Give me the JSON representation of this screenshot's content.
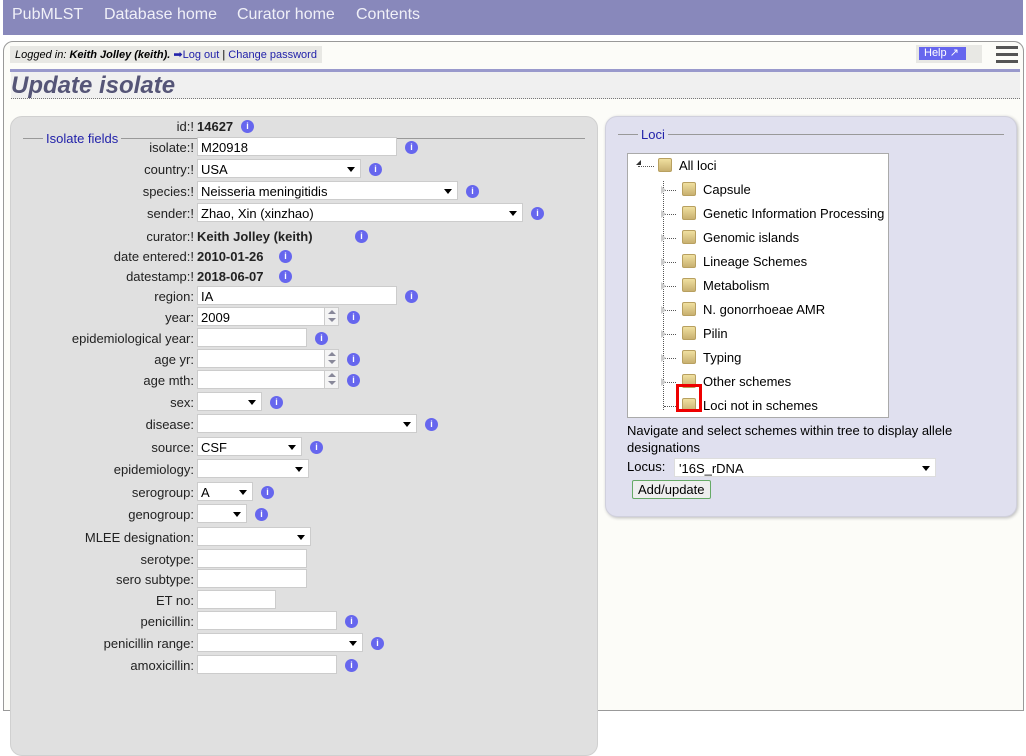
{
  "nav": [
    "PubMLST",
    "Database home",
    "Curator home",
    "Contents"
  ],
  "login": {
    "prefix": "Logged in:",
    "user": "Keith Jolley (keith).",
    "logout": "Log out",
    "sep": "|",
    "change_password": "Change password"
  },
  "help": "Help",
  "title": "Update isolate",
  "isolate_fields": {
    "legend": "Isolate fields",
    "fields": [
      {
        "label": "id:!",
        "type": "text",
        "value": "14627"
      },
      {
        "label": "isolate:!",
        "type": "input",
        "value": "M20918"
      },
      {
        "label": "country:!",
        "type": "select",
        "value": "USA"
      },
      {
        "label": "species:!",
        "type": "select",
        "value": "Neisseria meningitidis"
      },
      {
        "label": "sender:!",
        "type": "select",
        "value": "Zhao, Xin (xinzhao)"
      },
      {
        "label": "curator:!",
        "type": "text",
        "value": "Keith Jolley (keith)"
      },
      {
        "label": "date entered:!",
        "type": "text",
        "value": "2010-01-26"
      },
      {
        "label": "datestamp:!",
        "type": "text",
        "value": "2018-06-07"
      },
      {
        "label": "region:",
        "type": "input",
        "value": "IA"
      },
      {
        "label": "year:",
        "type": "number",
        "value": "2009"
      },
      {
        "label": "epidemiological year:",
        "type": "input",
        "value": ""
      },
      {
        "label": "age yr:",
        "type": "number",
        "value": ""
      },
      {
        "label": "age mth:",
        "type": "number",
        "value": ""
      },
      {
        "label": "sex:",
        "type": "select",
        "value": ""
      },
      {
        "label": "disease:",
        "type": "select",
        "value": ""
      },
      {
        "label": "source:",
        "type": "select",
        "value": "CSF"
      },
      {
        "label": "epidemiology:",
        "type": "select",
        "value": "",
        "noinfo": true
      },
      {
        "label": "serogroup:",
        "type": "select",
        "value": "A"
      },
      {
        "label": "genogroup:",
        "type": "select",
        "value": ""
      },
      {
        "label": "MLEE designation:",
        "type": "select",
        "value": "",
        "noinfo": true
      },
      {
        "label": "serotype:",
        "type": "input",
        "value": "",
        "noinfo": true
      },
      {
        "label": "sero subtype:",
        "type": "input",
        "value": "",
        "noinfo": true
      },
      {
        "label": "ET no:",
        "type": "input",
        "value": "",
        "noinfo": true
      },
      {
        "label": "penicillin:",
        "type": "input",
        "value": ""
      },
      {
        "label": "penicillin range:",
        "type": "select",
        "value": ""
      },
      {
        "label": "amoxicillin:",
        "type": "input",
        "value": ""
      }
    ]
  },
  "loci": {
    "legend": "Loci",
    "root": "All loci",
    "nodes": [
      "Capsule",
      "Genetic Information Processing",
      "Genomic islands",
      "Lineage Schemes",
      "Metabolism",
      "N. gonorrhoeae AMR",
      "Pilin",
      "Typing",
      "Other schemes",
      "Loci not in schemes"
    ],
    "highlighted": "Typing",
    "instructions": "Navigate and select schemes within tree to display allele designations",
    "locus_label": "Locus:",
    "locus_value": "'16S_rDNA",
    "add_button": "Add/update"
  },
  "colors": {
    "nav": "#8888bb",
    "info": "#6666ee",
    "highlight": "#ee0000"
  }
}
